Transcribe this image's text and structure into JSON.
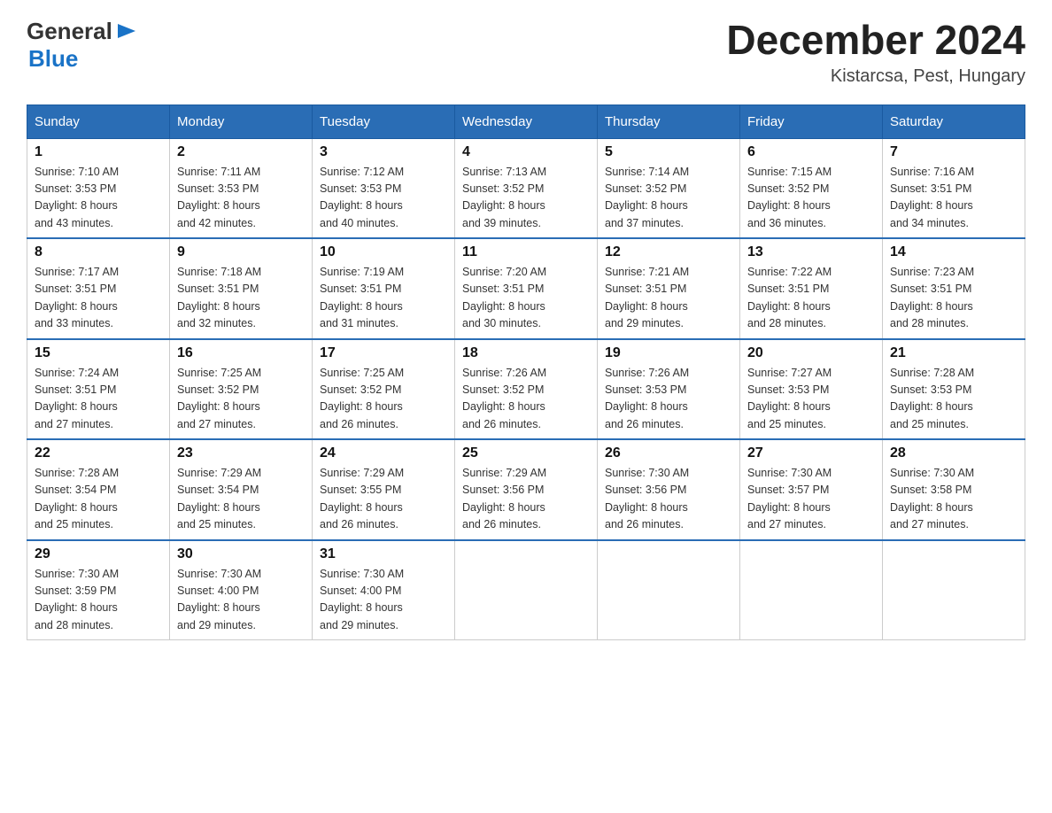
{
  "header": {
    "logo_text_general": "General",
    "logo_text_blue": "Blue",
    "month_title": "December 2024",
    "location": "Kistarcsa, Pest, Hungary"
  },
  "weekdays": [
    "Sunday",
    "Monday",
    "Tuesday",
    "Wednesday",
    "Thursday",
    "Friday",
    "Saturday"
  ],
  "weeks": [
    [
      {
        "day": "1",
        "sunrise": "Sunrise: 7:10 AM",
        "sunset": "Sunset: 3:53 PM",
        "daylight": "Daylight: 8 hours",
        "daylight2": "and 43 minutes."
      },
      {
        "day": "2",
        "sunrise": "Sunrise: 7:11 AM",
        "sunset": "Sunset: 3:53 PM",
        "daylight": "Daylight: 8 hours",
        "daylight2": "and 42 minutes."
      },
      {
        "day": "3",
        "sunrise": "Sunrise: 7:12 AM",
        "sunset": "Sunset: 3:53 PM",
        "daylight": "Daylight: 8 hours",
        "daylight2": "and 40 minutes."
      },
      {
        "day": "4",
        "sunrise": "Sunrise: 7:13 AM",
        "sunset": "Sunset: 3:52 PM",
        "daylight": "Daylight: 8 hours",
        "daylight2": "and 39 minutes."
      },
      {
        "day": "5",
        "sunrise": "Sunrise: 7:14 AM",
        "sunset": "Sunset: 3:52 PM",
        "daylight": "Daylight: 8 hours",
        "daylight2": "and 37 minutes."
      },
      {
        "day": "6",
        "sunrise": "Sunrise: 7:15 AM",
        "sunset": "Sunset: 3:52 PM",
        "daylight": "Daylight: 8 hours",
        "daylight2": "and 36 minutes."
      },
      {
        "day": "7",
        "sunrise": "Sunrise: 7:16 AM",
        "sunset": "Sunset: 3:51 PM",
        "daylight": "Daylight: 8 hours",
        "daylight2": "and 34 minutes."
      }
    ],
    [
      {
        "day": "8",
        "sunrise": "Sunrise: 7:17 AM",
        "sunset": "Sunset: 3:51 PM",
        "daylight": "Daylight: 8 hours",
        "daylight2": "and 33 minutes."
      },
      {
        "day": "9",
        "sunrise": "Sunrise: 7:18 AM",
        "sunset": "Sunset: 3:51 PM",
        "daylight": "Daylight: 8 hours",
        "daylight2": "and 32 minutes."
      },
      {
        "day": "10",
        "sunrise": "Sunrise: 7:19 AM",
        "sunset": "Sunset: 3:51 PM",
        "daylight": "Daylight: 8 hours",
        "daylight2": "and 31 minutes."
      },
      {
        "day": "11",
        "sunrise": "Sunrise: 7:20 AM",
        "sunset": "Sunset: 3:51 PM",
        "daylight": "Daylight: 8 hours",
        "daylight2": "and 30 minutes."
      },
      {
        "day": "12",
        "sunrise": "Sunrise: 7:21 AM",
        "sunset": "Sunset: 3:51 PM",
        "daylight": "Daylight: 8 hours",
        "daylight2": "and 29 minutes."
      },
      {
        "day": "13",
        "sunrise": "Sunrise: 7:22 AM",
        "sunset": "Sunset: 3:51 PM",
        "daylight": "Daylight: 8 hours",
        "daylight2": "and 28 minutes."
      },
      {
        "day": "14",
        "sunrise": "Sunrise: 7:23 AM",
        "sunset": "Sunset: 3:51 PM",
        "daylight": "Daylight: 8 hours",
        "daylight2": "and 28 minutes."
      }
    ],
    [
      {
        "day": "15",
        "sunrise": "Sunrise: 7:24 AM",
        "sunset": "Sunset: 3:51 PM",
        "daylight": "Daylight: 8 hours",
        "daylight2": "and 27 minutes."
      },
      {
        "day": "16",
        "sunrise": "Sunrise: 7:25 AM",
        "sunset": "Sunset: 3:52 PM",
        "daylight": "Daylight: 8 hours",
        "daylight2": "and 27 minutes."
      },
      {
        "day": "17",
        "sunrise": "Sunrise: 7:25 AM",
        "sunset": "Sunset: 3:52 PM",
        "daylight": "Daylight: 8 hours",
        "daylight2": "and 26 minutes."
      },
      {
        "day": "18",
        "sunrise": "Sunrise: 7:26 AM",
        "sunset": "Sunset: 3:52 PM",
        "daylight": "Daylight: 8 hours",
        "daylight2": "and 26 minutes."
      },
      {
        "day": "19",
        "sunrise": "Sunrise: 7:26 AM",
        "sunset": "Sunset: 3:53 PM",
        "daylight": "Daylight: 8 hours",
        "daylight2": "and 26 minutes."
      },
      {
        "day": "20",
        "sunrise": "Sunrise: 7:27 AM",
        "sunset": "Sunset: 3:53 PM",
        "daylight": "Daylight: 8 hours",
        "daylight2": "and 25 minutes."
      },
      {
        "day": "21",
        "sunrise": "Sunrise: 7:28 AM",
        "sunset": "Sunset: 3:53 PM",
        "daylight": "Daylight: 8 hours",
        "daylight2": "and 25 minutes."
      }
    ],
    [
      {
        "day": "22",
        "sunrise": "Sunrise: 7:28 AM",
        "sunset": "Sunset: 3:54 PM",
        "daylight": "Daylight: 8 hours",
        "daylight2": "and 25 minutes."
      },
      {
        "day": "23",
        "sunrise": "Sunrise: 7:29 AM",
        "sunset": "Sunset: 3:54 PM",
        "daylight": "Daylight: 8 hours",
        "daylight2": "and 25 minutes."
      },
      {
        "day": "24",
        "sunrise": "Sunrise: 7:29 AM",
        "sunset": "Sunset: 3:55 PM",
        "daylight": "Daylight: 8 hours",
        "daylight2": "and 26 minutes."
      },
      {
        "day": "25",
        "sunrise": "Sunrise: 7:29 AM",
        "sunset": "Sunset: 3:56 PM",
        "daylight": "Daylight: 8 hours",
        "daylight2": "and 26 minutes."
      },
      {
        "day": "26",
        "sunrise": "Sunrise: 7:30 AM",
        "sunset": "Sunset: 3:56 PM",
        "daylight": "Daylight: 8 hours",
        "daylight2": "and 26 minutes."
      },
      {
        "day": "27",
        "sunrise": "Sunrise: 7:30 AM",
        "sunset": "Sunset: 3:57 PM",
        "daylight": "Daylight: 8 hours",
        "daylight2": "and 27 minutes."
      },
      {
        "day": "28",
        "sunrise": "Sunrise: 7:30 AM",
        "sunset": "Sunset: 3:58 PM",
        "daylight": "Daylight: 8 hours",
        "daylight2": "and 27 minutes."
      }
    ],
    [
      {
        "day": "29",
        "sunrise": "Sunrise: 7:30 AM",
        "sunset": "Sunset: 3:59 PM",
        "daylight": "Daylight: 8 hours",
        "daylight2": "and 28 minutes."
      },
      {
        "day": "30",
        "sunrise": "Sunrise: 7:30 AM",
        "sunset": "Sunset: 4:00 PM",
        "daylight": "Daylight: 8 hours",
        "daylight2": "and 29 minutes."
      },
      {
        "day": "31",
        "sunrise": "Sunrise: 7:30 AM",
        "sunset": "Sunset: 4:00 PM",
        "daylight": "Daylight: 8 hours",
        "daylight2": "and 29 minutes."
      },
      null,
      null,
      null,
      null
    ]
  ]
}
